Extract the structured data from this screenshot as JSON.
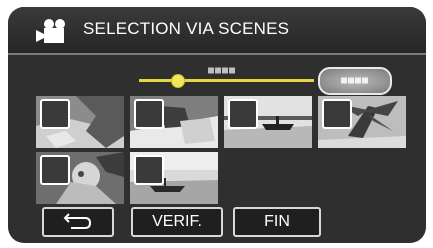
{
  "header": {
    "title": "SELECTION VIA SCENES",
    "icon": "movie-camera-icon"
  },
  "navigation": {
    "page_indicator": "■■■■",
    "page_button_label": "■■■■",
    "position_fraction": 0.22
  },
  "thumbnails": [
    {
      "name": "scene-thumbnail-1",
      "checked": false
    },
    {
      "name": "scene-thumbnail-2",
      "checked": false
    },
    {
      "name": "scene-thumbnail-3",
      "checked": false
    },
    {
      "name": "scene-thumbnail-4",
      "checked": false
    },
    {
      "name": "scene-thumbnail-5",
      "checked": false
    },
    {
      "name": "scene-thumbnail-6",
      "checked": false
    }
  ],
  "buttons": {
    "back_icon": "return-arrow-icon",
    "verif_label": "VERIF.",
    "fin_label": "FIN"
  },
  "colors": {
    "background": "#2f2f2f",
    "slider": "#e2d740"
  }
}
